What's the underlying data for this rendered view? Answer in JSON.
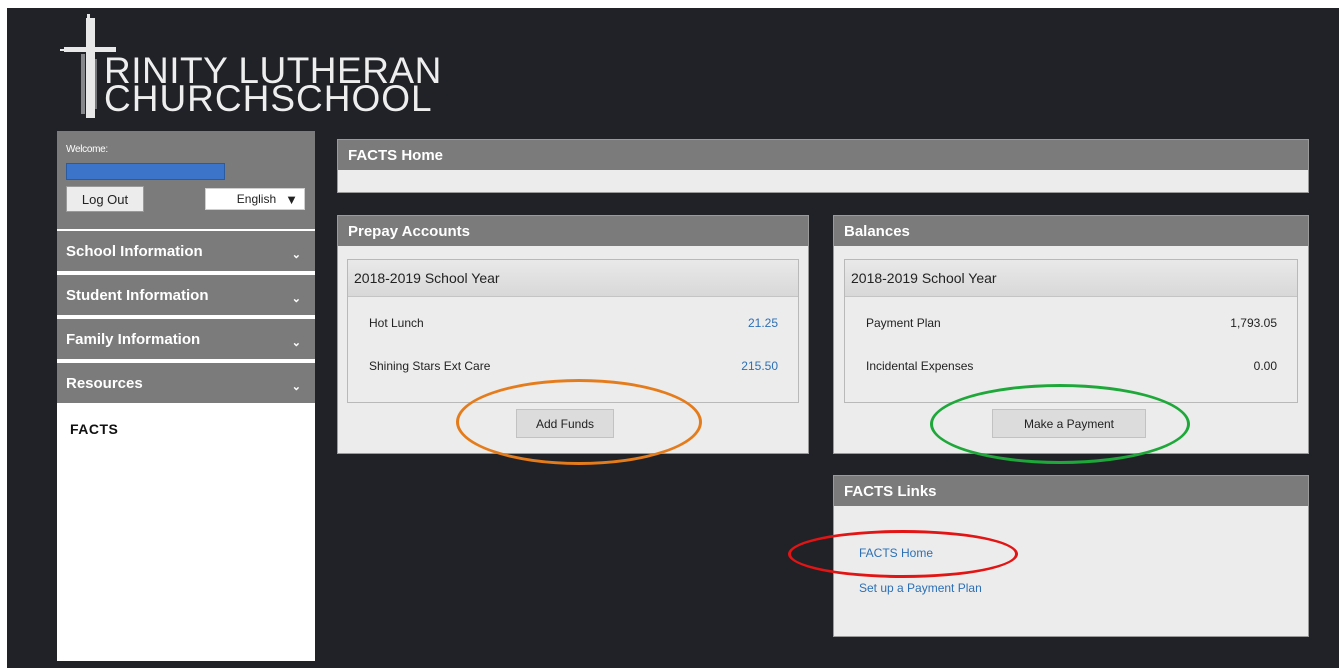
{
  "logo": {
    "line1": "RINITY LUTHERAN",
    "line2": "CHURCHSCHOOL"
  },
  "sidebar": {
    "welcome_label": "Welcome:",
    "logout_label": "Log Out",
    "language": "English",
    "items": [
      {
        "label": "School Information"
      },
      {
        "label": "Student Information"
      },
      {
        "label": "Family Information"
      },
      {
        "label": "Resources"
      }
    ],
    "active_item": "FACTS"
  },
  "main": {
    "title": "FACTS Home",
    "prepay": {
      "header": "Prepay Accounts",
      "year": "2018-2019 School Year",
      "rows": [
        {
          "label": "Hot Lunch",
          "value": "21.25"
        },
        {
          "label": "Shining Stars Ext Care",
          "value": "215.50"
        }
      ],
      "button": "Add Funds"
    },
    "balances": {
      "header": "Balances",
      "year": "2018-2019 School Year",
      "rows": [
        {
          "label": "Payment Plan",
          "value": "1,793.05"
        },
        {
          "label": "Incidental Expenses",
          "value": "0.00"
        }
      ],
      "button": "Make a Payment"
    },
    "links": {
      "header": "FACTS Links",
      "items": [
        {
          "label": "FACTS Home"
        },
        {
          "label": "Set up a Payment Plan"
        }
      ]
    }
  },
  "colors": {
    "background": "#202228",
    "panel_header": "#7b7b7b",
    "link": "#2c6fb5",
    "highlight_orange": "#e57c1c",
    "highlight_green": "#1ea83a",
    "highlight_red": "#e31414"
  }
}
